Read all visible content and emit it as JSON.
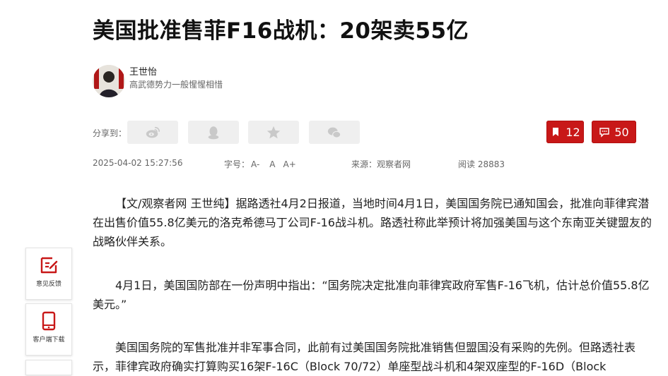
{
  "article": {
    "title": "美国批准售菲F16战机：20架卖55亿",
    "author": {
      "name": "王世怡",
      "bio": "高武德势力一般惺惺相惜"
    },
    "share": {
      "label": "分享到：",
      "buttons": [
        {
          "icon": "weibo-icon"
        },
        {
          "icon": "qq-icon"
        },
        {
          "icon": "qzone-star-icon"
        },
        {
          "icon": "wechat-icon"
        }
      ]
    },
    "counts": {
      "bookmark": "12",
      "comments": "50"
    },
    "meta": {
      "date": "2025-04-02 15:27:56",
      "font_label": "字号：",
      "font_small": "A-",
      "font_normal": "A",
      "font_large": "A+",
      "source": "来源：观察者网",
      "views": "阅读 28883"
    },
    "paragraphs": [
      "【文/观察者网 王世纯】据路透社4月2日报道，当地时间4月1日，美国国务院已通知国会，批准向菲律宾潜在出售价值55.8亿美元的洛克希德马丁公司F-16战斗机。路透社称此举预计将加强美国与这个东南亚关键盟友的战略伙伴关系。",
      "4月1日，美国国防部在一份声明中指出：“国务院决定批准向菲律宾政府军售F-16飞机，估计总价值55.8亿美元。”",
      "美国国务院的军售批准并非军事合同，此前有过美国国务院批准销售但盟国没有采购的先例。但路透社表示，菲律宾政府确实打算购买16架F-16C（Block 70/72）单座型战斗机和4架双座型的F-16D（Block"
    ]
  },
  "float_tools": [
    {
      "label": "意见反馈",
      "icon": "feedback-edit-icon"
    },
    {
      "label": "客户端下载",
      "icon": "mobile-phone-icon"
    }
  ],
  "colors": {
    "accent": "#c81818",
    "share_bg": "#efefef"
  }
}
